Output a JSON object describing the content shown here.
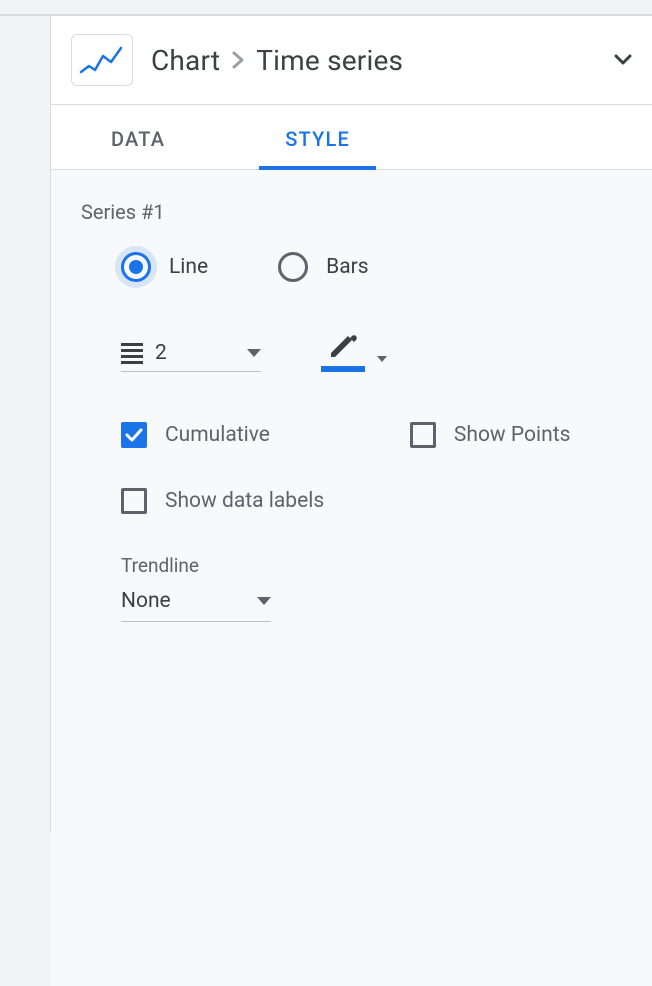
{
  "header": {
    "breadcrumb_root": "Chart",
    "breadcrumb_current": "Time series"
  },
  "tabs": {
    "data": "DATA",
    "style": "STYLE"
  },
  "style_panel": {
    "series_title": "Series #1",
    "series_type": {
      "line_label": "Line",
      "bars_label": "Bars"
    },
    "line_weight": "2",
    "cumulative_label": "Cumulative",
    "show_points_label": "Show Points",
    "show_data_labels_label": "Show data labels",
    "trendline_label": "Trendline",
    "trendline_value": "None"
  }
}
